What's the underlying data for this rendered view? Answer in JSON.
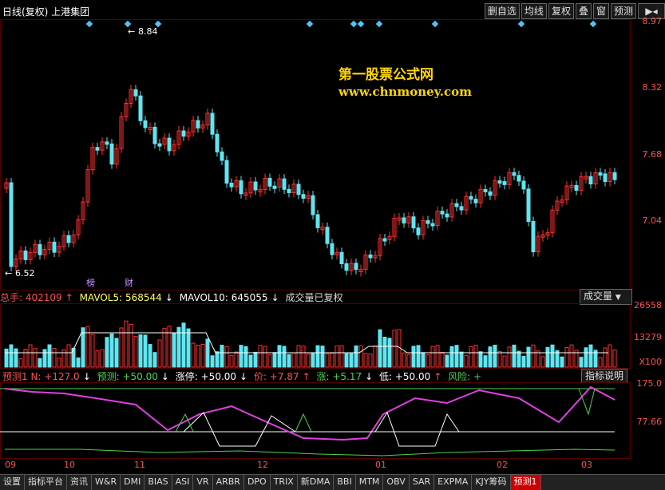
{
  "header": {
    "title": "日线(复权) 上港集团"
  },
  "toolbar": {
    "buttons": [
      "删自选",
      "均线",
      "复权",
      "叠",
      "窗",
      "预测"
    ]
  },
  "price_axis": [
    "8.97",
    "8.32",
    "7.68",
    "7.04"
  ],
  "price_marks": {
    "high": "8.84",
    "low": "6.52"
  },
  "event_labels": {
    "bang": "榜",
    "cai": "财"
  },
  "watermark": {
    "line1": "第一股票公式网",
    "line2": "www.chnmoney.com"
  },
  "volume": {
    "total_label": "总手: 402109",
    "mavol5": "MAVOL5: 568544",
    "mavol10": "MAVOL10: 645055",
    "note": "成交量已复权",
    "dropdown": "成交量",
    "axis": [
      "26558",
      "13279",
      "X100"
    ]
  },
  "indicator": {
    "name": "预测1 N: +127.0",
    "yuce": "预测: +50.00",
    "zhangting": "涨停: +50.00",
    "jia": "价: +7.87",
    "zhang": "涨: +5.17",
    "di": "低: +50.00",
    "fengxian": "风险: +",
    "button": "指标说明",
    "axis": [
      "175.0",
      "77.66"
    ]
  },
  "dates": [
    "09",
    "10",
    "11",
    "12",
    "01",
    "02",
    "03"
  ],
  "tabs": [
    "设置",
    "指标平台",
    "资讯",
    "W&R",
    "DMI",
    "BIAS",
    "ASI",
    "VR",
    "ARBR",
    "DPO",
    "TRIX",
    "新DMA",
    "BBI",
    "MTM",
    "OBV",
    "SAR",
    "EXPMA",
    "KJY筹码",
    "预测1"
  ],
  "colors": {
    "up": "#ff3030",
    "down": "#5fe6f0",
    "line_magenta": "#e040e0",
    "line_white": "#ffffff",
    "line_green": "#50d050"
  }
}
